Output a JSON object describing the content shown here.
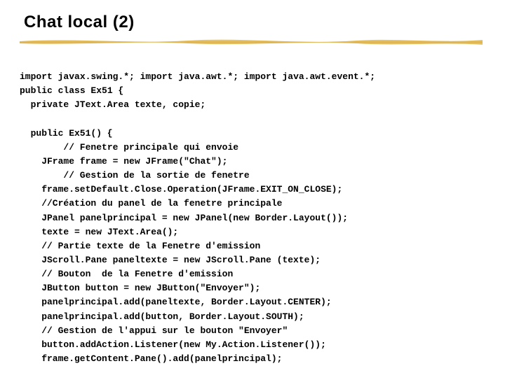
{
  "title": "Chat local (2)",
  "code": {
    "l01": "import javax.swing.*; import java.awt.*; import java.awt.event.*;",
    "l02": "public class Ex51 {",
    "l03": "private JText.Area texte, copie;",
    "l04": "public Ex51() {",
    "l05": "// Fenetre principale qui envoie",
    "l06": "JFrame frame = new JFrame(\"Chat\");",
    "l07": "// Gestion de la sortie de fenetre",
    "l08": "frame.setDefault.Close.Operation(JFrame.EXIT_ON_CLOSE);",
    "l09": "//Création du panel de la fenetre principale",
    "l10": "JPanel panelprincipal = new JPanel(new Border.Layout());",
    "l11": "texte = new JText.Area();",
    "l12": "// Partie texte de la Fenetre d'emission",
    "l13": "JScroll.Pane paneltexte = new JScroll.Pane (texte);",
    "l14": "// Bouton  de la Fenetre d'emission",
    "l15": "JButton button = new JButton(\"Envoyer\");",
    "l16": "panelprincipal.add(paneltexte, Border.Layout.CENTER);",
    "l17": "panelprincipal.add(button, Border.Layout.SOUTH);",
    "l18": "// Gestion de l'appui sur le bouton \"Envoyer\"",
    "l19": "button.addAction.Listener(new My.Action.Listener());",
    "l20": "frame.getContent.Pane().add(panelprincipal);"
  }
}
